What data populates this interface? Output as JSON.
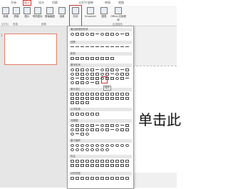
{
  "ribbon": {
    "tabs": [
      "开始",
      "插入",
      "设计",
      "切换",
      "幻灯片放映",
      "审阅",
      "视图"
    ],
    "buttons": {
      "new_slide": "新建",
      "table": "表格",
      "images": "图片",
      "online_images": "联机图片",
      "screenshot": "屏幕截图",
      "album": "相册",
      "shapes": "形状",
      "smartart": "SmartArt",
      "chart": "图表",
      "office_apps": "Office 应用程序"
    },
    "groups": {
      "slides": "幻灯片",
      "tables": "表格",
      "images": "图像",
      "apps": "应用程序"
    }
  },
  "slides_pane": {
    "slide_number": "1"
  },
  "shapes_panel": {
    "sections": [
      "最近使用的形状",
      "线条",
      "矩形",
      "基本形状",
      "箭头总汇",
      "公式形状",
      "流程图",
      "星与旗帜",
      "标注",
      "动作按钮"
    ],
    "tooltip": "梯形"
  },
  "slide": {
    "title_fragment": "单击此"
  }
}
